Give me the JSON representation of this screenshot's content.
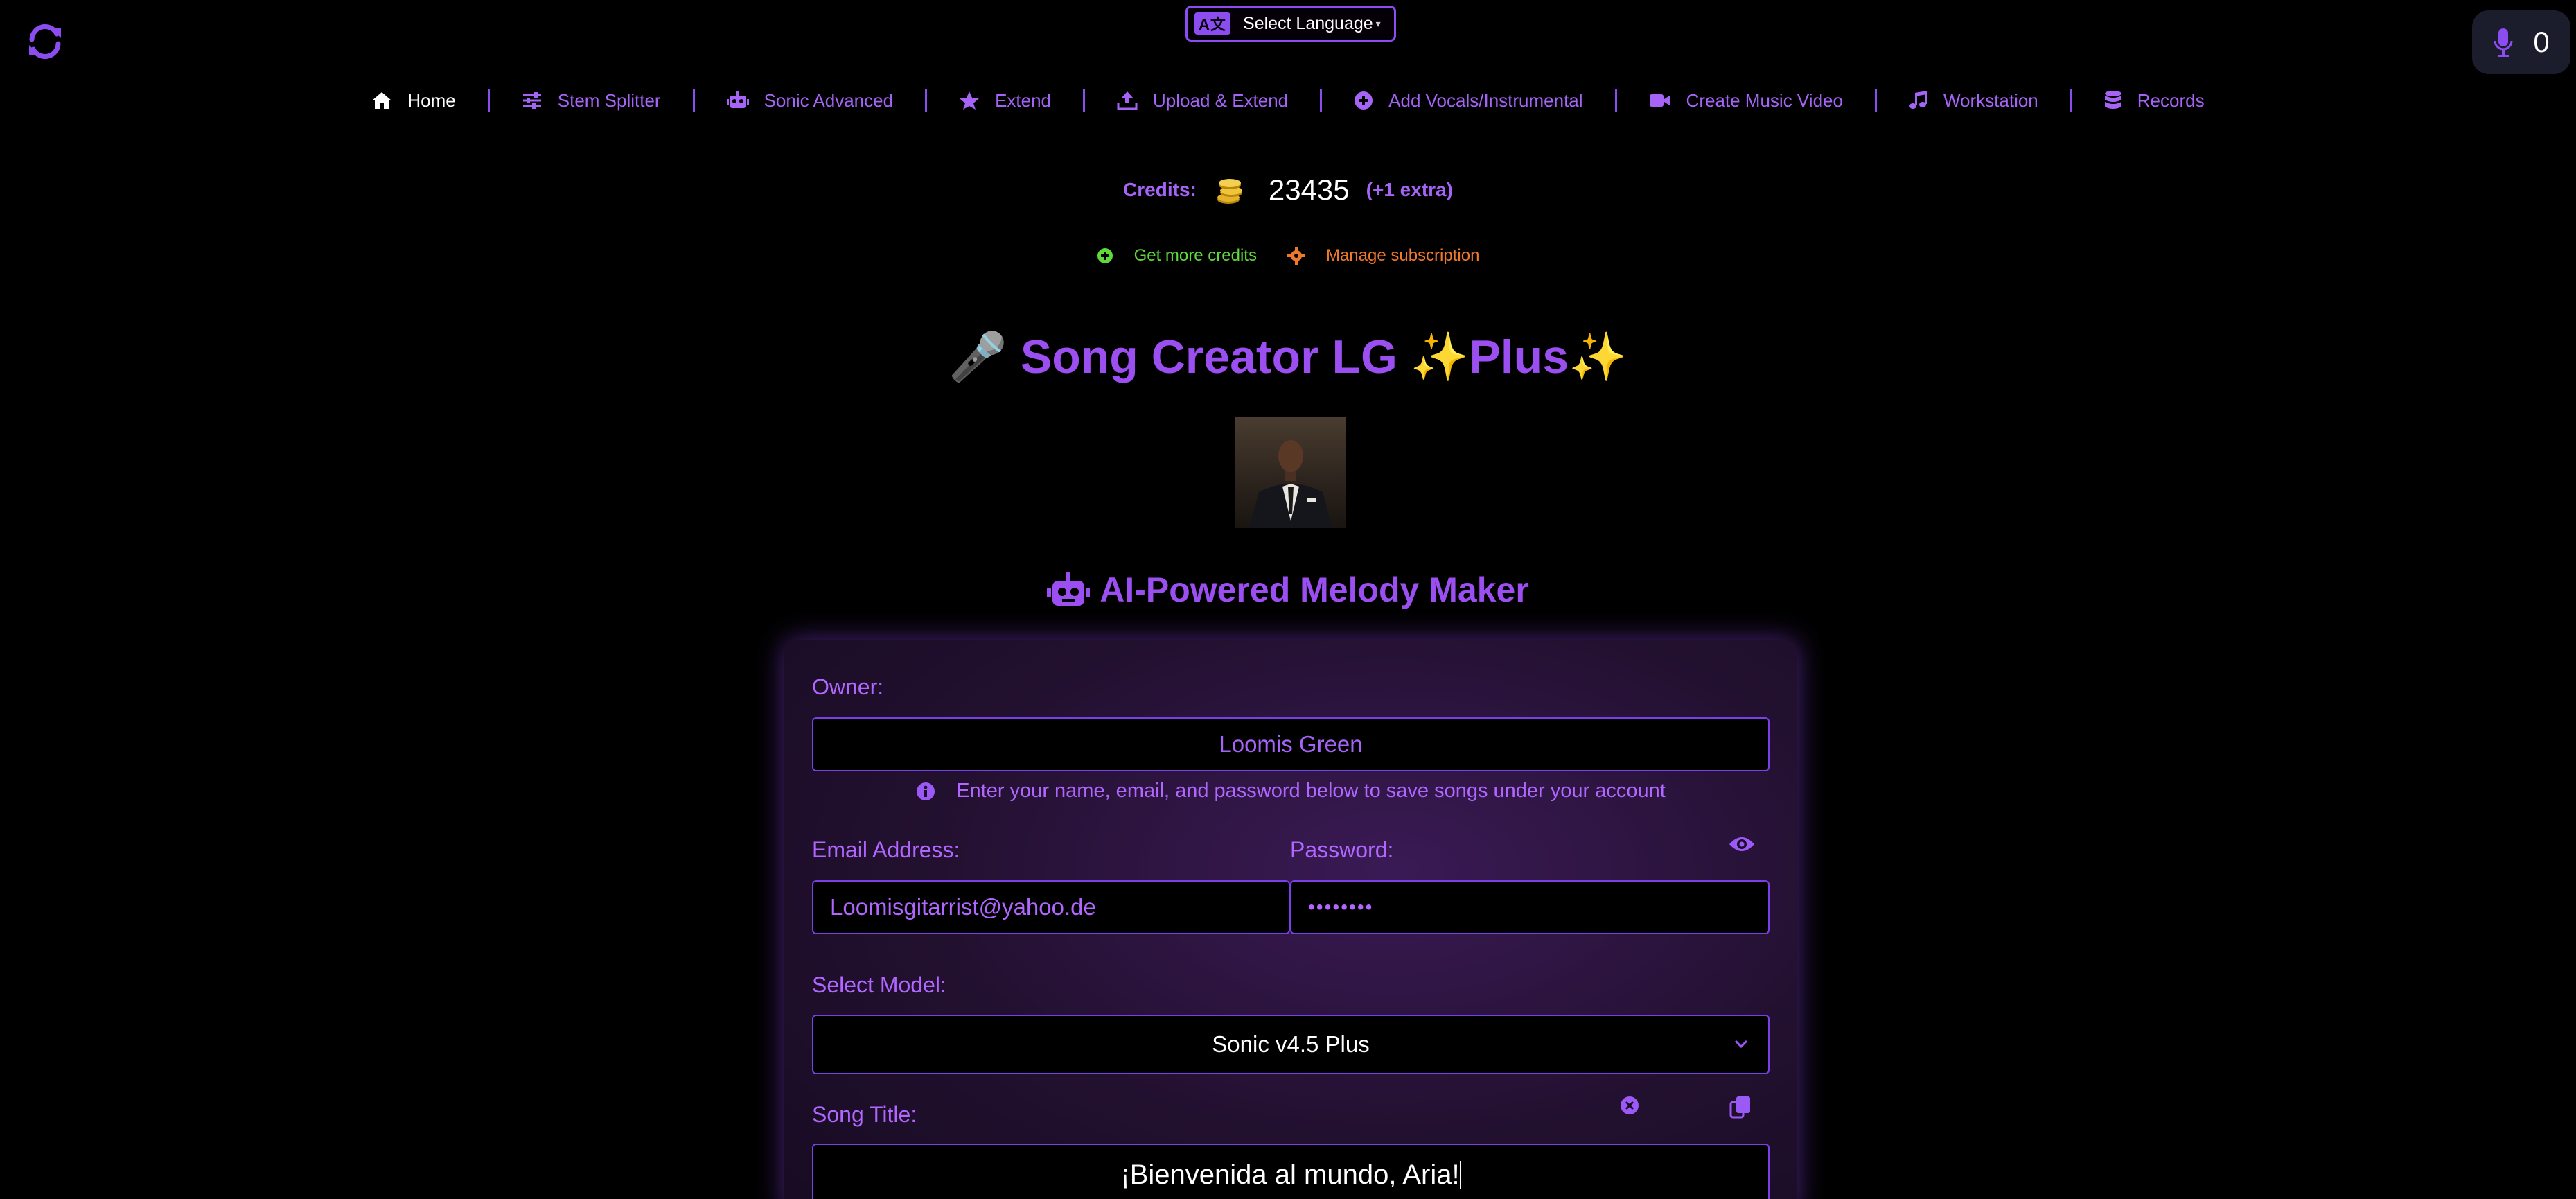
{
  "header": {
    "language_button": "Select Language",
    "language_badge": "A文",
    "mic_count": "0"
  },
  "nav": {
    "items": [
      {
        "label": "Home",
        "icon": "home-icon"
      },
      {
        "label": "Stem Splitter",
        "icon": "sliders-icon"
      },
      {
        "label": "Sonic Advanced",
        "icon": "robot-icon"
      },
      {
        "label": "Extend",
        "icon": "star-icon"
      },
      {
        "label": "Upload & Extend",
        "icon": "upload-icon"
      },
      {
        "label": "Add Vocals/Instrumental",
        "icon": "plus-circle-icon"
      },
      {
        "label": "Create Music Video",
        "icon": "video-icon"
      },
      {
        "label": "Workstation",
        "icon": "music-note-icon"
      },
      {
        "label": "Records",
        "icon": "database-icon"
      }
    ]
  },
  "credits": {
    "label": "Credits:",
    "value": "23435",
    "extra": "(+1 extra)",
    "get_more": "Get more credits",
    "manage": "Manage subscription"
  },
  "page": {
    "title": "Song Creator LG ✨Plus✨",
    "subtitle": "AI-Powered Melody Maker"
  },
  "form": {
    "owner_label": "Owner:",
    "owner_value": "Loomis Green",
    "hint": "Enter your name, email, and password below to save songs under your account",
    "email_label": "Email Address:",
    "email_value": "Loomisgitarrist@yahoo.de",
    "password_label": "Password:",
    "password_value": "••••••••",
    "model_label": "Select Model:",
    "model_value": "Sonic v4.5 Plus",
    "song_title_label": "Song Title:",
    "song_title_value": "¡Bienvenida al mundo, Aria!"
  },
  "colors": {
    "accent": "#9b59f5",
    "background": "#000000",
    "green": "#5edb3b",
    "orange": "#f0782a"
  }
}
